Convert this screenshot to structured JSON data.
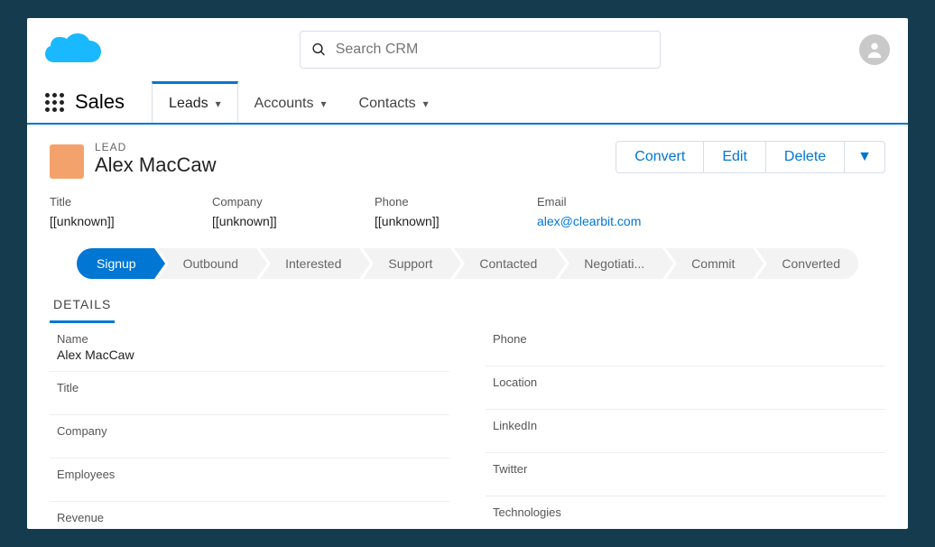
{
  "search": {
    "placeholder": "Search CRM"
  },
  "nav": {
    "app_name": "Sales",
    "tabs": [
      {
        "label": "Leads",
        "active": true
      },
      {
        "label": "Accounts",
        "active": false
      },
      {
        "label": "Contacts",
        "active": false
      }
    ]
  },
  "lead": {
    "type": "LEAD",
    "name": "Alex MacCaw"
  },
  "actions": {
    "convert": "Convert",
    "edit": "Edit",
    "delete": "Delete"
  },
  "info": {
    "title_label": "Title",
    "title_val": "[[unknown]]",
    "company_label": "Company",
    "company_val": "[[unknown]]",
    "phone_label": "Phone",
    "phone_val": "[[unknown]]",
    "email_label": "Email",
    "email_val": "alex@clearbit.com"
  },
  "stages": [
    "Signup",
    "Outbound",
    "Interested",
    "Support",
    "Contacted",
    "Negotiati...",
    "Commit",
    "Converted"
  ],
  "active_stage": 0,
  "details_tab": "DETAILS",
  "details": {
    "left": [
      {
        "label": "Name",
        "value": "Alex MacCaw"
      },
      {
        "label": "Title",
        "value": ""
      },
      {
        "label": "Company",
        "value": ""
      },
      {
        "label": "Employees",
        "value": ""
      },
      {
        "label": "Revenue",
        "value": ""
      }
    ],
    "right": [
      {
        "label": "Phone",
        "value": ""
      },
      {
        "label": "Location",
        "value": ""
      },
      {
        "label": "LinkedIn",
        "value": ""
      },
      {
        "label": "Twitter",
        "value": ""
      },
      {
        "label": "Technologies",
        "value": ""
      }
    ]
  }
}
